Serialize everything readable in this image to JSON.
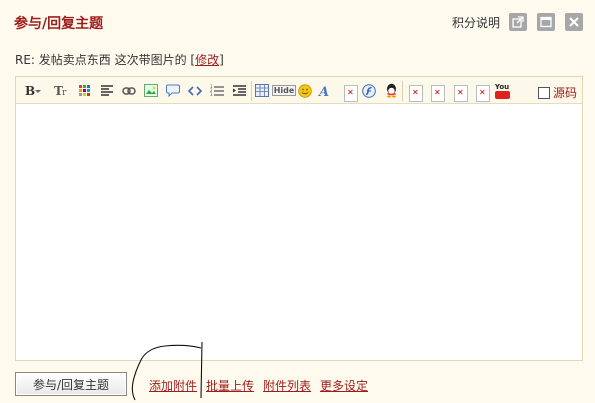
{
  "dialog": {
    "title": "参与/回复主题",
    "credits_link": "积分说明",
    "window_buttons": [
      "popout-icon",
      "maximize-icon",
      "close-icon"
    ]
  },
  "subject": {
    "prefix": "RE: 发帖卖点东西  这次带图片的  [",
    "edit_link": "修改",
    "suffix": "]"
  },
  "toolbar": {
    "icons": [
      "bold-icon",
      "font-size-icon",
      "color-grid-icon",
      "align-icon",
      "link-icon",
      "image-icon",
      "quote-icon",
      "code-icon",
      "ordered-list-icon",
      "indent-icon",
      "table-icon",
      "hide-icon",
      "smiley-icon",
      "text-style-icon",
      "flash-icon",
      "qq-icon",
      "youtube-icon"
    ],
    "hide_label": "Hide",
    "youtube_label": "You",
    "source_label": "源码",
    "source_checked": false
  },
  "footer": {
    "submit_label": "参与/回复主题",
    "links": [
      "添加附件",
      "批量上传",
      "附件列表",
      "更多设定"
    ]
  },
  "colors": {
    "accent": "#9e1c1c",
    "background": "#fefbee",
    "toolbar_bg": "#fcf8ea",
    "border": "#e2d7b5"
  }
}
